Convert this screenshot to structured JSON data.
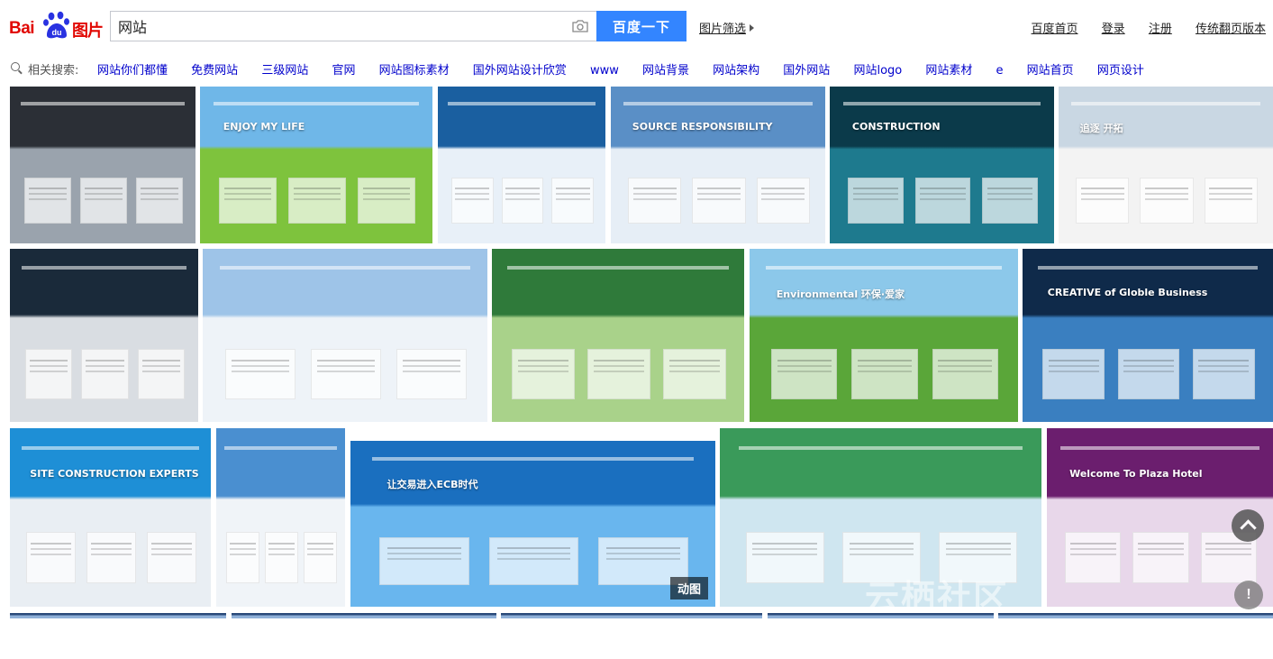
{
  "logo": {
    "text_bai": "Bai",
    "text_du": "du",
    "text_tupian": "图片"
  },
  "search": {
    "query": "网站",
    "button_label": "百度一下",
    "filter_label": "图片筛选"
  },
  "top_links": [
    "百度首页",
    "登录",
    "注册",
    "传统翻页版本"
  ],
  "related": {
    "label": "相关搜索:",
    "items": [
      "网站你们都懂",
      "免费网站",
      "三级网站",
      "官网",
      "网站图标素材",
      "国外网站设计欣赏",
      "www",
      "网站背景",
      "网站架构",
      "国外网站",
      "网站logo",
      "网站素材",
      "e",
      "网站首页",
      "网页设计"
    ]
  },
  "tiles": [
    {
      "row": 1,
      "caption": "",
      "colors": [
        "#2b2f36",
        "#9aa3ad"
      ]
    },
    {
      "row": 1,
      "caption": "ENJOY MY LIFE",
      "colors": [
        "#6fb7e8",
        "#7ec33d"
      ]
    },
    {
      "row": 1,
      "caption": "",
      "colors": [
        "#1a5fa0",
        "#e8f0f8"
      ]
    },
    {
      "row": 1,
      "caption": "SOURCE RESPONSIBILITY",
      "colors": [
        "#5a8fc6",
        "#e6eef6"
      ]
    },
    {
      "row": 1,
      "caption": "CONSTRUCTION",
      "colors": [
        "#0b3a4a",
        "#1e7a8e"
      ]
    },
    {
      "row": 1,
      "caption": "追逐 开拓",
      "colors": [
        "#c9d7e3",
        "#f3f3f3"
      ]
    },
    {
      "row": 2,
      "caption": "",
      "colors": [
        "#1a2a3a",
        "#d9dde2"
      ]
    },
    {
      "row": 2,
      "caption": "",
      "colors": [
        "#9ec4e8",
        "#eef3f8"
      ]
    },
    {
      "row": 2,
      "caption": "",
      "colors": [
        "#2f7a3a",
        "#a9d28a"
      ]
    },
    {
      "row": 2,
      "caption": "Environmental 环保·爱家",
      "colors": [
        "#8cc8ea",
        "#5aa639"
      ]
    },
    {
      "row": 2,
      "caption": "CREATIVE of Globle Business",
      "colors": [
        "#0f2a4a",
        "#3a7fc0"
      ]
    },
    {
      "row": 3,
      "caption": "SITE CONSTRUCTION EXPERTS",
      "colors": [
        "#1e8fd6",
        "#e9eef3"
      ]
    },
    {
      "row": 3,
      "caption": "",
      "colors": [
        "#4a8fd0",
        "#f0f4f8"
      ]
    },
    {
      "row": 3,
      "caption": "让交易进入ECB时代",
      "colors": [
        "#1a6fbf",
        "#69b6ee"
      ],
      "badge": "动图"
    },
    {
      "row": 3,
      "caption": "",
      "colors": [
        "#3a9a5a",
        "#cfe6f0"
      ]
    },
    {
      "row": 3,
      "caption": "Welcome To Plaza Hotel",
      "colors": [
        "#6b1e6e",
        "#e8d7ea"
      ]
    }
  ],
  "scroll_top": "top",
  "feedback": "!",
  "watermark": "云栖社区 yq.aliyun.com",
  "colors": {
    "accent": "#3385ff",
    "logo_red": "#e10601",
    "paw_blue": "#2932e1",
    "link_blue": "#0000cc"
  }
}
